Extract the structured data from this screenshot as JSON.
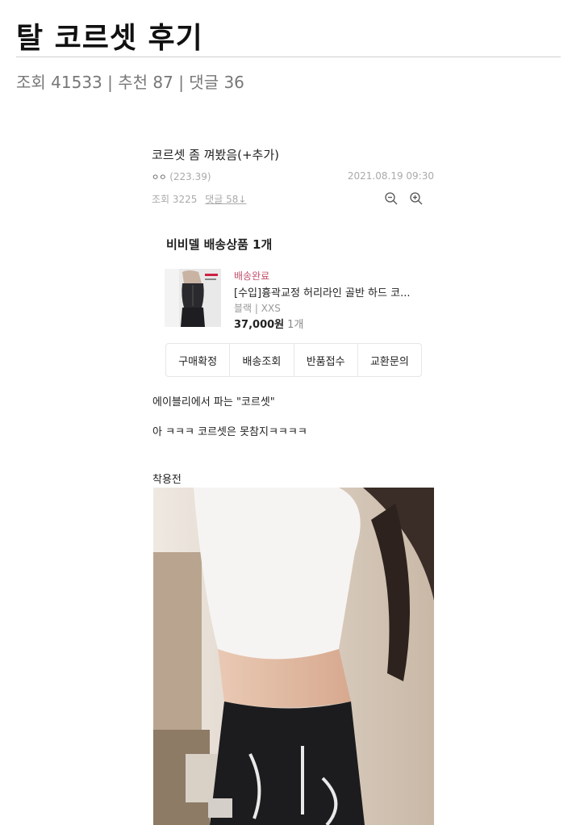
{
  "header": {
    "title": "탈 코르셋 후기",
    "stats": "조회 41533 | 추천 87 | 댓글 36"
  },
  "inner_post": {
    "title": "코르셋 좀 껴봤음(+추가)",
    "author_mark": "ㅇㅇ",
    "author_ip": "(223.39)",
    "date": "2021.08.19 09:30",
    "views": "조회 3225",
    "comments_link": "댓글 58↓",
    "zoom_out_icon": "zoom-out-icon",
    "zoom_in_icon": "zoom-in-icon"
  },
  "order": {
    "store": "비비델 배송상품 1개",
    "status": "배송완료",
    "product_name": "[수입]흉곽교정 허리라인 골반 하드 코...",
    "option": "블랙 | XXS",
    "price": "37,000원",
    "quantity": "1개",
    "actions": [
      "구매확정",
      "배송조회",
      "반품접수",
      "교환문의"
    ],
    "status_color": "#c0506b"
  },
  "body": {
    "para1": "에이블리에서 파는 \"코르셋\"",
    "para2": "아 ㅋㅋㅋ 코르셋은 못참지ㅋㅋㅋㅋ",
    "para3": "착용전"
  }
}
